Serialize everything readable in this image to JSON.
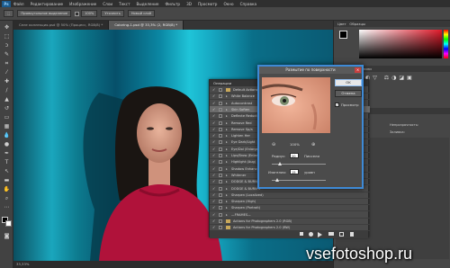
{
  "menu": {
    "app_logo": "Ps",
    "items": [
      "Файл",
      "Редактирование",
      "Изображение",
      "Слои",
      "Текст",
      "Выделение",
      "Фильтр",
      "3D",
      "Просмотр",
      "Окно",
      "Справка"
    ]
  },
  "options_bar": {
    "tool_mode": "Прямоугольное выделение",
    "width_label": "100%",
    "refine_button": "Уточнить",
    "mask_button": "Новый слой"
  },
  "tabs": [
    {
      "label": "Селе коллекция.psd @ 50% (Процесс, RGB/8) *",
      "active": false
    },
    {
      "label": "Coloring-1.psd @ 33,3% (2, RGB/8) *",
      "active": true
    }
  ],
  "status": {
    "zoom": "33,33%"
  },
  "actions_panel": {
    "title": "Операции",
    "rows": [
      {
        "label": "Default Actions",
        "checked": true,
        "folder": true
      },
      {
        "label": "White Balance",
        "checked": true
      },
      {
        "label": "Autocontrast",
        "checked": true
      },
      {
        "label": "Skin Soften",
        "checked": true,
        "selected": true
      },
      {
        "label": "Deflecte Reduction",
        "checked": true
      },
      {
        "label": "Remove Red",
        "checked": true
      },
      {
        "label": "Remove Sp/a",
        "checked": true
      },
      {
        "label": "Lighten Her",
        "checked": true
      },
      {
        "label": "Eye Dark/Light",
        "checked": true
      },
      {
        "label": "Eye/Dol (Enlarge)",
        "checked": true
      },
      {
        "label": "Lips/Brow (Enlarge)",
        "checked": true
      },
      {
        "label": "Highlight (Aug)",
        "checked": true
      },
      {
        "label": "Shadow Enhance",
        "checked": true
      },
      {
        "label": "Whitener",
        "checked": true
      },
      {
        "label": "DODGE & BURN",
        "checked": true
      },
      {
        "label": "DODGE & BURN 1",
        "checked": true
      },
      {
        "label": "Sharpen (Localized)",
        "checked": true
      },
      {
        "label": "Sharpen (High)",
        "checked": true
      },
      {
        "label": "Sharpen (Portrait)",
        "checked": true
      },
      {
        "label": "—FRAMES—",
        "checked": true
      },
      {
        "label": "Actions for Photographers 2.0 (RGB)",
        "checked": true,
        "folder": true
      },
      {
        "label": "Actions for Photographers 2.0 (BW)",
        "checked": true,
        "folder": true
      }
    ]
  },
  "dialog": {
    "title": "Размытие по поверхности",
    "close": "×",
    "ok": "OK",
    "cancel": "Отмена",
    "preview_label": "Просмотр",
    "zoom_value": "100%",
    "radius_label": "Радиус:",
    "radius_value": "20",
    "radius_unit": "Пиксели",
    "threshold_label": "Изогелия:",
    "threshold_value": "15",
    "threshold_unit": "уровн"
  },
  "right_panel": {
    "color_tab": "Цвет",
    "swatches_tab": "Образцы",
    "adjust_tab": "Коррекция",
    "styles_tab": "Стили",
    "layers_tab": "Слои",
    "channels_tab": "Каналы",
    "kind_label": "Вид",
    "opacity_label": "Непрозрачность:",
    "fill_label": "Заливка:"
  },
  "watermark": "vsefotoshop.ru"
}
